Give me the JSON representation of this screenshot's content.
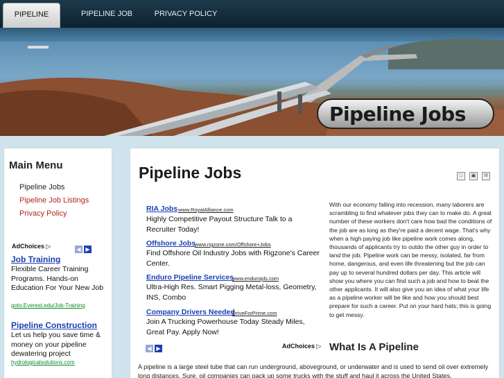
{
  "nav": {
    "tabs": [
      {
        "label": "PIPELINE JOBS",
        "active": true
      },
      {
        "label": "PIPELINE JOB LISTINGS",
        "active": false
      },
      {
        "label": "PRIVACY POLICY",
        "active": false
      }
    ]
  },
  "banner": {
    "logo_text": "Pipeline Jobs"
  },
  "sidebar": {
    "title": "Main Menu",
    "menu": [
      {
        "label": "Pipeline Jobs"
      },
      {
        "label": "Pipeline Job Listings"
      },
      {
        "label": "Privacy Policy"
      }
    ],
    "adchoices_label": "AdChoices",
    "ads": [
      {
        "title": "Job Training",
        "body": "Flexible Career Training Programs. Hands-on Education For Your New Job",
        "url": "goto.Everest.edu/Job-Training"
      },
      {
        "title": "Pipeline Construction",
        "body": "Let us help you save time & money on your pipeline dewatering project",
        "url": "hydrologicalsolutions.com"
      }
    ]
  },
  "main": {
    "title": "Pipeline Jobs",
    "ads": [
      {
        "title": "RIA Jobs",
        "url": "www.RoyalAlliance.com",
        "body": "Highly Competitive Payout Structure Talk to a Recruiter Today!"
      },
      {
        "title": "Offshore Jobs",
        "url": "www.rigzone.com/Offshore+Jobs",
        "body": "Find Offshore Oil Industry Jobs with Rigzone's Career Center."
      },
      {
        "title": "Enduro Pipeline Services",
        "url": "www.enduropls.com",
        "body": "Ultra-High Res. Smart Pigging Metal-loss, Geometry, INS, Combo"
      },
      {
        "title": "Company Drivers Needed",
        "url": "DriveForPrime.com",
        "body": "Join A Trucking Powerhouse Today Steady Miles, Great Pay. Apply Now!"
      }
    ],
    "adchoices_label": "AdChoices",
    "article": "With our economy falling into recession, many laborers are scrambling to find whatever jobs they can to make do. A great number of these workers don't care how bad the conditions of the job are as long as they're paid a decent wage. That's why when a high paying job like pipeline work comes along, thousands of applicants try to outdo the other guy in order to land the job. Pipeline work can be messy, isolated, far from home, dangerous, and even life threatening but the job can pay up to several hundred dollars per day. This article will show you where you can find such a job and how to beat the other applicants. It will also give you an idea of what your life as a pipeline worker will be like and how you should best prepare for such a career. Put on your hard hats; this is going to get messy.",
    "subheading": "What Is A Pipeline",
    "bottom_text": "A pipeline is a large steel tube that can run underground, aboveground, or underwater and is used to send oil over extremely long distances. Sure, oil companies can pack up some trucks with the stuff and haul it across the United States,"
  }
}
